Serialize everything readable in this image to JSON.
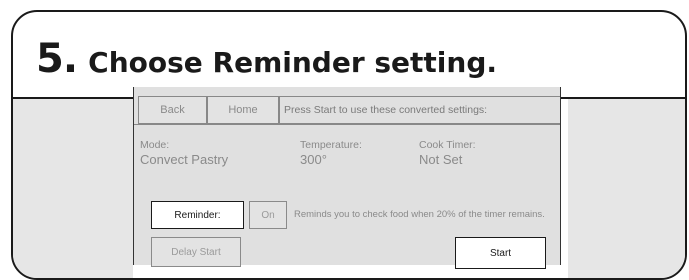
{
  "header": {
    "step_number": "5.",
    "step_text": "Choose Reminder setting."
  },
  "nav": {
    "back_label": "Back",
    "home_label": "Home",
    "message": "Press Start to use these converted settings:"
  },
  "settings": {
    "mode_label": "Mode:",
    "mode_value": "Convect Pastry",
    "temperature_label": "Temperature:",
    "temperature_value": "300°",
    "cook_timer_label": "Cook Timer:",
    "cook_timer_value": "Not Set"
  },
  "reminder": {
    "button_label": "Reminder:",
    "toggle_label": "On",
    "hint": "Reminds you to check food when 20% of the timer remains."
  },
  "actions": {
    "delay_start_label": "Delay Start",
    "start_label": "Start"
  }
}
